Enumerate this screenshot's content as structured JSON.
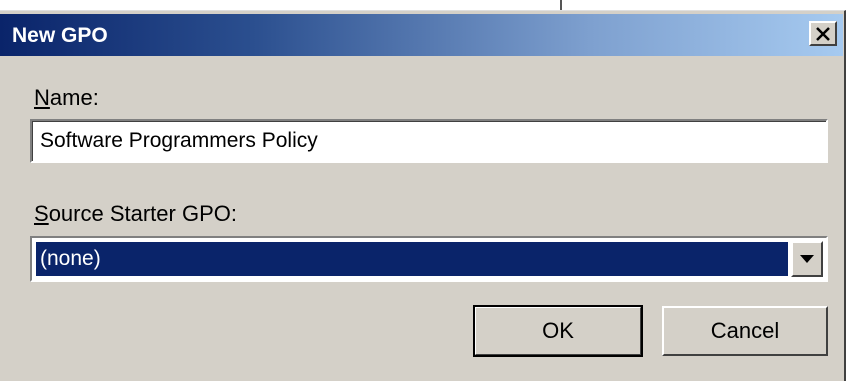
{
  "window": {
    "title": "New GPO",
    "close_icon": "close-icon"
  },
  "form": {
    "name_label_accel": "N",
    "name_label_rest": "ame:",
    "name_value": "Software Programmers Policy",
    "source_label_accel": "S",
    "source_label_rest": "ource Starter GPO:",
    "source_selected": "(none)",
    "source_arrow_icon": "chevron-down-icon"
  },
  "buttons": {
    "ok_label": "OK",
    "cancel_label": "Cancel"
  },
  "colors": {
    "dialog_bg": "#d4d0c8",
    "titlebar_start": "#0a246a",
    "titlebar_end": "#a6caf0",
    "selection_bg": "#0a246a"
  }
}
